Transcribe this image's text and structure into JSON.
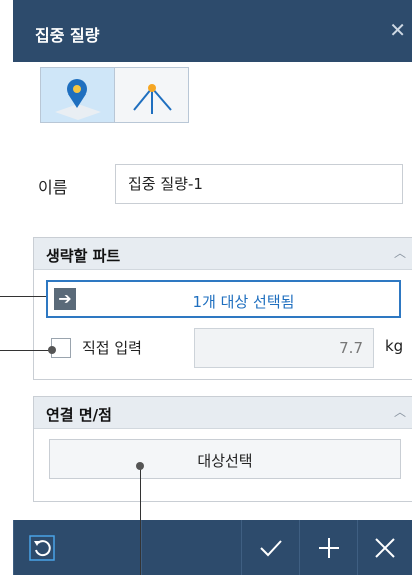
{
  "window": {
    "title": "집중 질량"
  },
  "modes": [
    {
      "name": "point-mass-mode",
      "selected": true
    },
    {
      "name": "distributed-mass-mode",
      "selected": false
    }
  ],
  "name_field": {
    "label": "이름",
    "value": "집중 질량-1"
  },
  "exclude_parts": {
    "title": "생략할 파트",
    "select_button": "1개 대상 선택됨",
    "direct_input": {
      "label": "직접 입력",
      "checked": false,
      "value": "7.7",
      "unit": "kg"
    }
  },
  "connect_faces": {
    "title": "연결 면/점",
    "select_button": "대상선택"
  },
  "footer": {
    "icons": [
      "reset-icon",
      "check-icon",
      "plus-icon",
      "close-icon"
    ]
  },
  "colors": {
    "header": "#2d4b6c",
    "accent": "#2e78c2",
    "mode_selected": "#cfe6f8"
  }
}
